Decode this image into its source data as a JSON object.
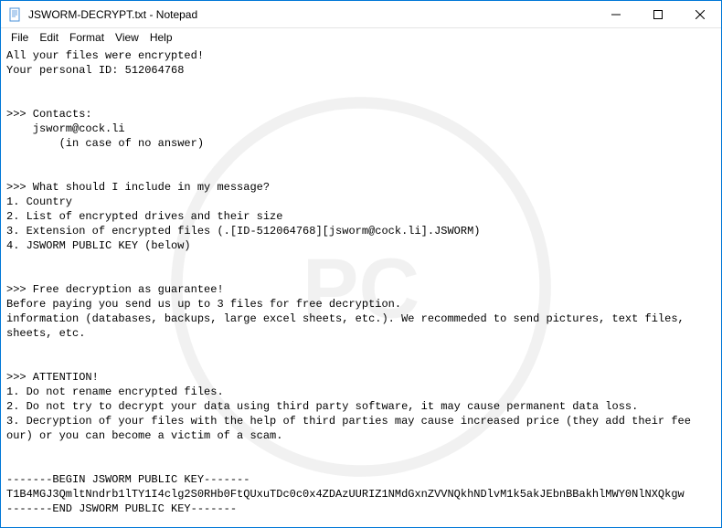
{
  "window": {
    "title": "JSWORM-DECRYPT.txt - Notepad"
  },
  "menu": {
    "file": "File",
    "edit": "Edit",
    "format": "Format",
    "view": "View",
    "help": "Help"
  },
  "doc": {
    "l01": "All your files were encrypted!",
    "l02": "Your personal ID: 512064768",
    "l03": "",
    "l04": "",
    "l05": ">>> Contacts:",
    "l06": "    jsworm@cock.li",
    "l07": "        (in case of no answer)",
    "l08": "",
    "l09": "",
    "l10": ">>> What should I include in my message?",
    "l11": "1. Country",
    "l12": "2. List of encrypted drives and their size",
    "l13": "3. Extension of encrypted files (.[ID-512064768][jsworm@cock.li].JSWORM)",
    "l14": "4. JSWORM PUBLIC KEY (below)",
    "l15": "",
    "l16": "",
    "l17": ">>> Free decryption as guarantee!",
    "l18": "Before paying you send us up to 3 files for free decryption.",
    "l19": "information (databases, backups, large excel sheets, etc.). We recommeded to send pictures, text files,",
    "l20": "sheets, etc.",
    "l21": "",
    "l22": "",
    "l23": ">>> ATTENTION!",
    "l24": "1. Do not rename encrypted files.",
    "l25": "2. Do not try to decrypt your data using third party software, it may cause permanent data loss.",
    "l26": "3. Decryption of your files with the help of third parties may cause increased price (they add their fee",
    "l27": "our) or you can become a victim of a scam.",
    "l28": "",
    "l29": "",
    "l30": "-------BEGIN JSWORM PUBLIC KEY-------",
    "l31": "T1B4MGJ3QmltNndrb1lTY1I4clg2S0RHb0FtQUxuTDc0c0x4ZDAzUURIZ1NMdGxnZVVNQkhNDlvM1k5akJEbnBBakhlMWY0NlNXQkgw",
    "l32": "-------END JSWORM PUBLIC KEY-------"
  }
}
